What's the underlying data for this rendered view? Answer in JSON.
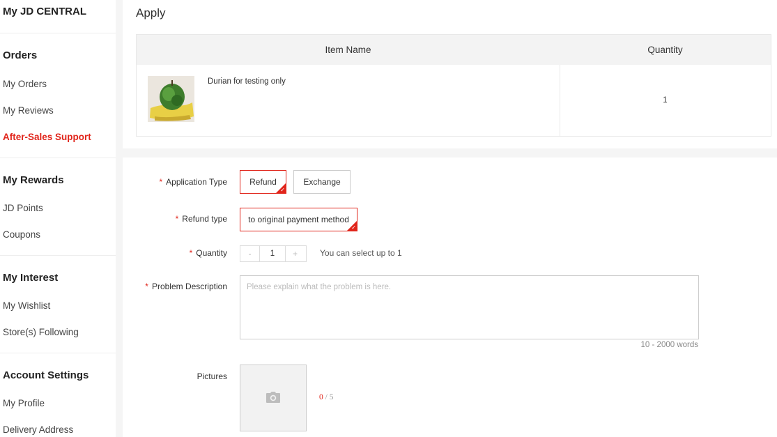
{
  "sidebar": {
    "title": "My JD CENTRAL",
    "sections": [
      {
        "heading": "Orders",
        "items": [
          "My Orders",
          "My Reviews",
          "After-Sales Support"
        ]
      },
      {
        "heading": "My Rewards",
        "items": [
          "JD Points",
          "Coupons"
        ]
      },
      {
        "heading": "My Interest",
        "items": [
          "My Wishlist",
          "Store(s) Following"
        ]
      },
      {
        "heading": "Account Settings",
        "items": [
          "My Profile",
          "Delivery Address"
        ]
      }
    ],
    "active_item": "After-Sales Support"
  },
  "apply": {
    "title": "Apply",
    "table": {
      "col_item_name": "Item Name",
      "col_quantity": "Quantity",
      "product_name": "Durian for testing only",
      "quantity": "1"
    }
  },
  "form": {
    "required_mark": "*",
    "application_type": {
      "label": "Application Type",
      "options": [
        "Refund",
        "Exchange"
      ],
      "selected": "Refund"
    },
    "refund_type": {
      "label": "Refund type",
      "options": [
        "to original payment method"
      ],
      "selected": "to original payment method"
    },
    "quantity": {
      "label": "Quantity",
      "minus": "-",
      "plus": "+",
      "value": "1",
      "hint": "You can select up to 1"
    },
    "problem_description": {
      "label": "Problem Description",
      "placeholder": "Please explain what the problem is here.",
      "value": "",
      "limit": "10 - 2000 words"
    },
    "pictures": {
      "label": "Pictures",
      "count_current": "0",
      "count_max": "/ 5"
    }
  },
  "icons": {
    "upload": "camera-icon",
    "selected": "check-corner-icon"
  },
  "colors": {
    "accent": "#e1251b",
    "border": "#cccccc",
    "header_bg": "#f3f3f3",
    "page_bg": "#f5f5f5"
  }
}
